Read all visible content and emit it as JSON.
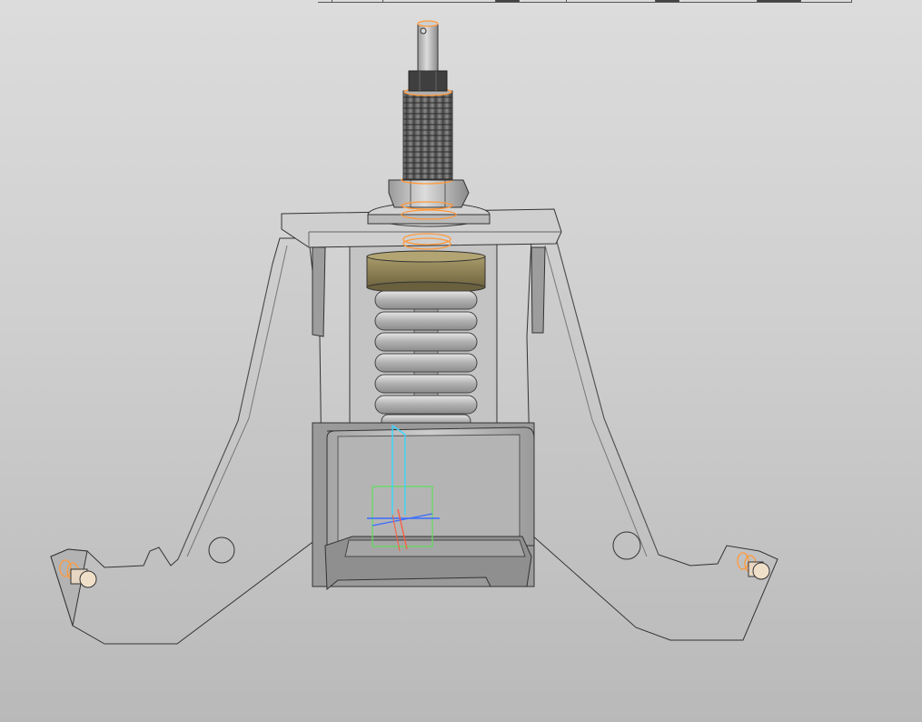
{
  "viewport": {
    "background_top": "#dcdcdc",
    "background_bottom": "#b9b9b9"
  },
  "toolstrip": {
    "segments": [
      "light",
      "light",
      "light",
      "dark",
      "light",
      "light",
      "dark",
      "light",
      "dark",
      "light"
    ]
  },
  "model": {
    "parts": [
      "threaded-stud",
      "hex-nut",
      "washer",
      "top-plate",
      "brass-collar",
      "compression-spring",
      "spring-cup",
      "side-bracket-left",
      "side-bracket-right",
      "mounting-bolt-left",
      "mounting-bolt-right"
    ],
    "colors": {
      "metal": "#c7c7c7",
      "metal_dark": "#8e8e8e",
      "edge": "#333333",
      "brass": "#8a7e58",
      "highlight": "#ff9a3c",
      "axis_cyan": "#3ad7ff",
      "axis_green": "#5ee05e",
      "axis_red": "#ff5a3c",
      "axis_blue": "#3a6cff"
    }
  }
}
